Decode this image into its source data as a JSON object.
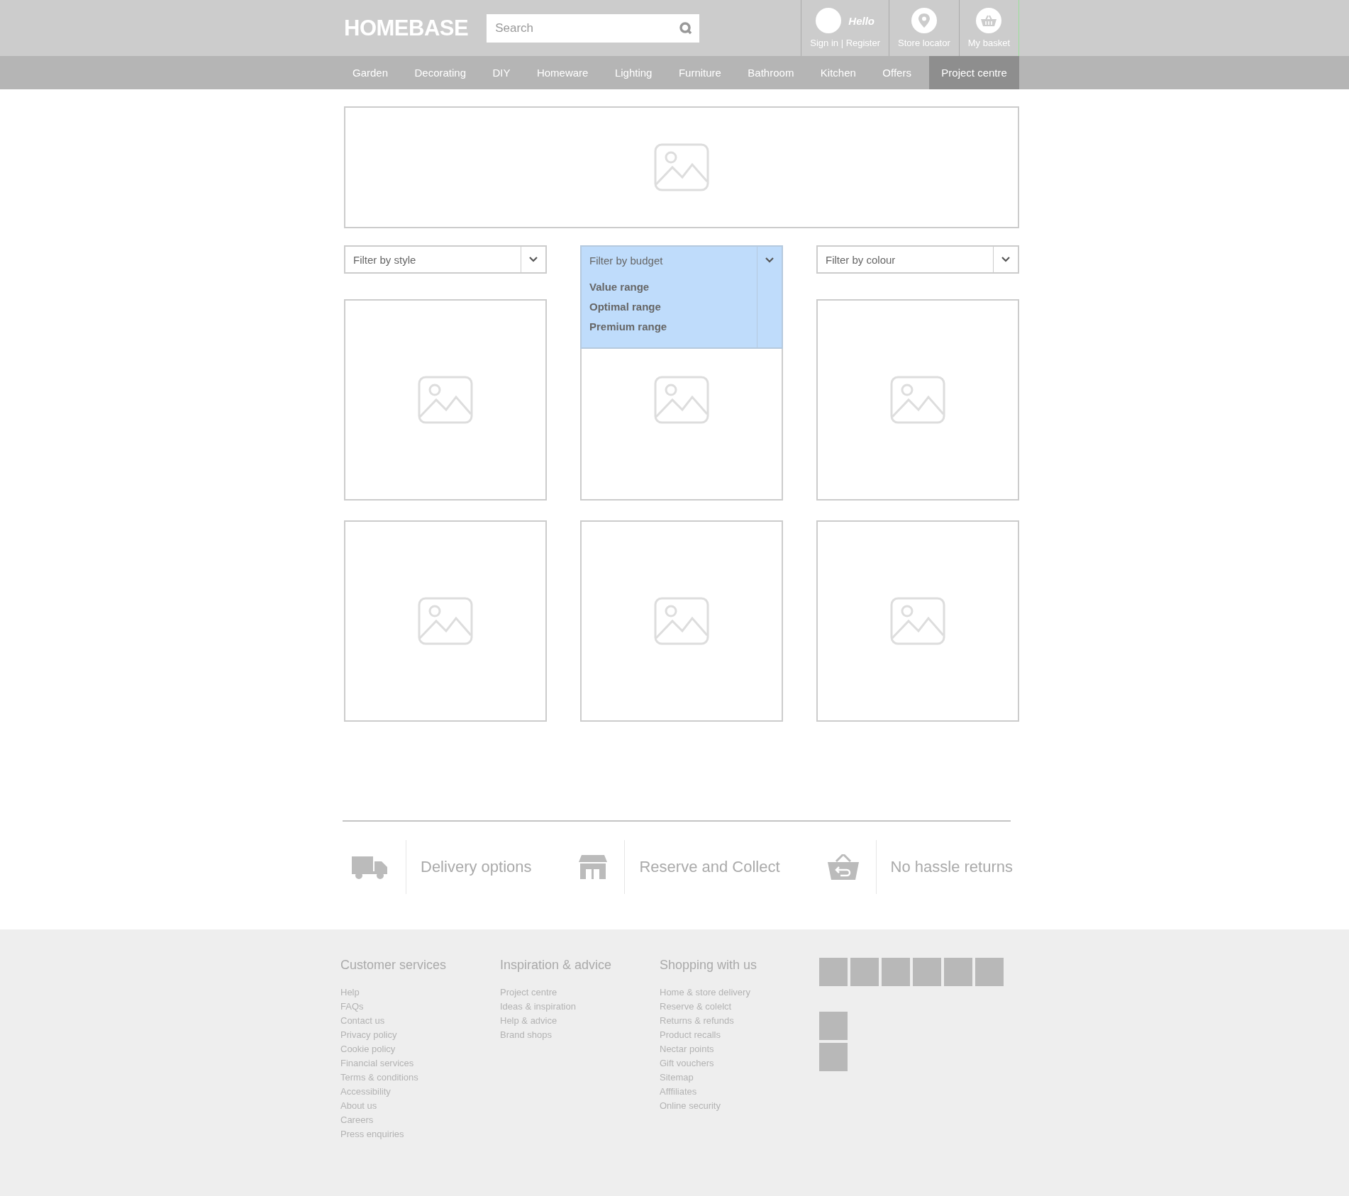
{
  "header": {
    "logo": "HOMEBASE",
    "search": {
      "placeholder": "Search"
    },
    "account": {
      "greeting": "Hello",
      "link": "Sign in | Register"
    },
    "store_locator": "Store locator",
    "basket": "My basket"
  },
  "nav": [
    {
      "label": "Garden",
      "selected": false
    },
    {
      "label": "Decorating",
      "selected": false
    },
    {
      "label": "DIY",
      "selected": false
    },
    {
      "label": "Homeware",
      "selected": false
    },
    {
      "label": "Lighting",
      "selected": false
    },
    {
      "label": "Furniture",
      "selected": false
    },
    {
      "label": "Bathroom",
      "selected": false
    },
    {
      "label": "Kitchen",
      "selected": false
    },
    {
      "label": "Offers",
      "selected": false
    },
    {
      "label": "Project centre",
      "selected": true
    }
  ],
  "filters": [
    {
      "label": "Filter by style",
      "expanded": false
    },
    {
      "label": "Filter by budget",
      "expanded": true,
      "options": [
        "Value range",
        "Optimal range",
        "Premium range"
      ]
    },
    {
      "label": "Filter by colour",
      "expanded": false
    }
  ],
  "features": [
    {
      "kind": "truck",
      "label": "Delivery options"
    },
    {
      "kind": "store",
      "label": "Reserve and Collect"
    },
    {
      "kind": "basket",
      "label": "No hassle returns"
    }
  ],
  "footer": {
    "columns": [
      {
        "heading": "Customer services",
        "links": [
          "Help",
          "FAQs",
          "Contact us",
          "Privacy policy",
          "Cookie policy",
          "Financial services",
          "Terms & conditions",
          "Accessibility",
          "About us",
          "Careers",
          "Press enquiries"
        ]
      },
      {
        "heading": "Inspiration & advice",
        "links": [
          "Project centre",
          "Ideas & inspiration",
          "Help & advice",
          "Brand shops"
        ]
      },
      {
        "heading": "Shopping with us",
        "links": [
          "Home & store delivery",
          "Reserve & colelct",
          "Returns & refunds",
          "Product recalls",
          "Nectar points",
          "Gift vouchers",
          "Sitemap",
          "Afffiliates",
          "Online security"
        ]
      }
    ]
  }
}
